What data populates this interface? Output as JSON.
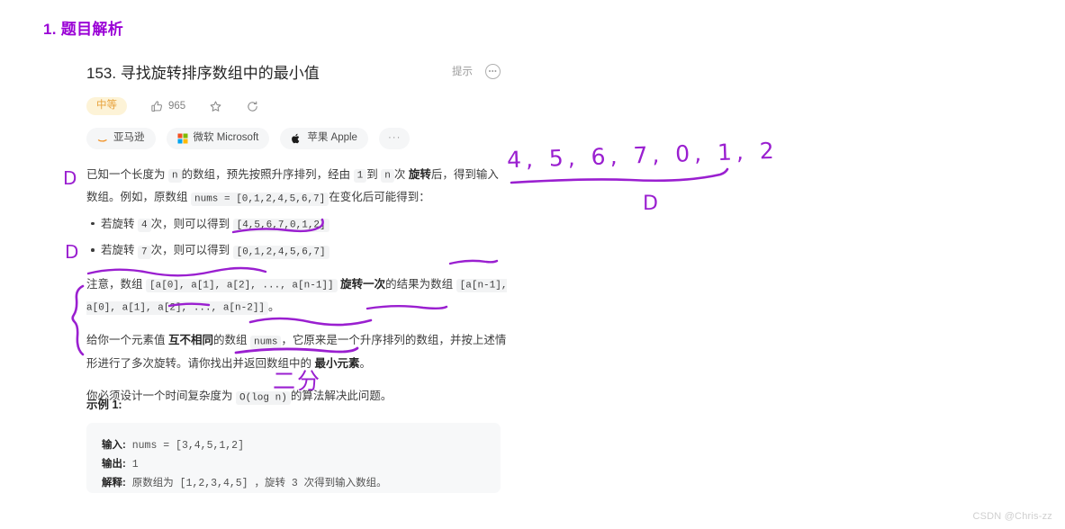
{
  "page": {
    "section_heading": "1. 题目解析",
    "watermark": "CSDN @Chris-zz",
    "ink_color": "#9a1fd0",
    "heading_color": "#9a01d6"
  },
  "problem": {
    "title": "153. 寻找旋转排序数组中的最小值",
    "hint_label": "提示",
    "hint_icon": "circle-ellipsis-icon",
    "difficulty": "中等",
    "likes": "965",
    "like_icon": "thumbs-up-icon",
    "star_icon": "star-outline-icon",
    "share_icon": "share-refresh-icon",
    "tags": [
      {
        "label": "亚马逊",
        "logo": "amazon-logo"
      },
      {
        "label": "微软 Microsoft",
        "logo": "microsoft-logo"
      },
      {
        "label": "苹果 Apple",
        "logo": "apple-logo"
      },
      {
        "label": "···",
        "logo": "more-dots"
      }
    ]
  },
  "description": {
    "p1_a": "已知一个长度为",
    "p1_code1": "n",
    "p1_b": "的数组，预先按照升序排列，经由",
    "p1_code2": "1",
    "p1_c": "到",
    "p1_code3": "n",
    "p1_d": "次",
    "p1_bold": "旋转",
    "p1_e": "后，得到输入数组。例如，原数组",
    "p1_code4": "nums = [0,1,2,4,5,6,7]",
    "p1_f": "在变化后可能得到：",
    "bullets": [
      {
        "a": "若旋转",
        "n": "4",
        "b": "次，则可以得到",
        "code": "[4,5,6,7,0,1,2]"
      },
      {
        "a": "若旋转",
        "n": "7",
        "b": "次，则可以得到",
        "code": "[0,1,2,4,5,6,7]"
      }
    ],
    "p2_a": "注意，数组",
    "p2_code1": "[a[0], a[1], a[2], ..., a[n-1]]",
    "p2_bold": "旋转一次",
    "p2_b": "的结果为数组",
    "p2_code2": "[a[n-1], a[0], a[1], a[2], ..., a[n-2]]",
    "p2_c": "。",
    "p3_a": "给你一个元素值",
    "p3_bold1": "互不相同",
    "p3_b": "的数组",
    "p3_code": "nums",
    "p3_c": "，它原来是一个升序排列的数组，并按上述情形进行了多次旋转。请你找出并返回数组中的",
    "p3_bold2": "最小元素",
    "p3_d": "。",
    "p4_a": "你必须设计一个时间复杂度为",
    "p4_code": "O(log n)",
    "p4_b": "的算法解决此问题。"
  },
  "example": {
    "title": "示例 1:",
    "input_label": "输入:",
    "input_value": "nums = [3,4,5,1,2]",
    "output_label": "输出:",
    "output_value": "1",
    "explain_label": "解释:",
    "explain_value": "原数组为 [1,2,3,4,5] ，旋转 3 次得到输入数组。"
  },
  "annotations": {
    "sequence": "4, 5, 6, 7, 0, 1,   2",
    "letter_d_under_sequence": "D",
    "margin_mark_1": "D",
    "margin_mark_2": "D",
    "binary_search_note": "二分"
  }
}
